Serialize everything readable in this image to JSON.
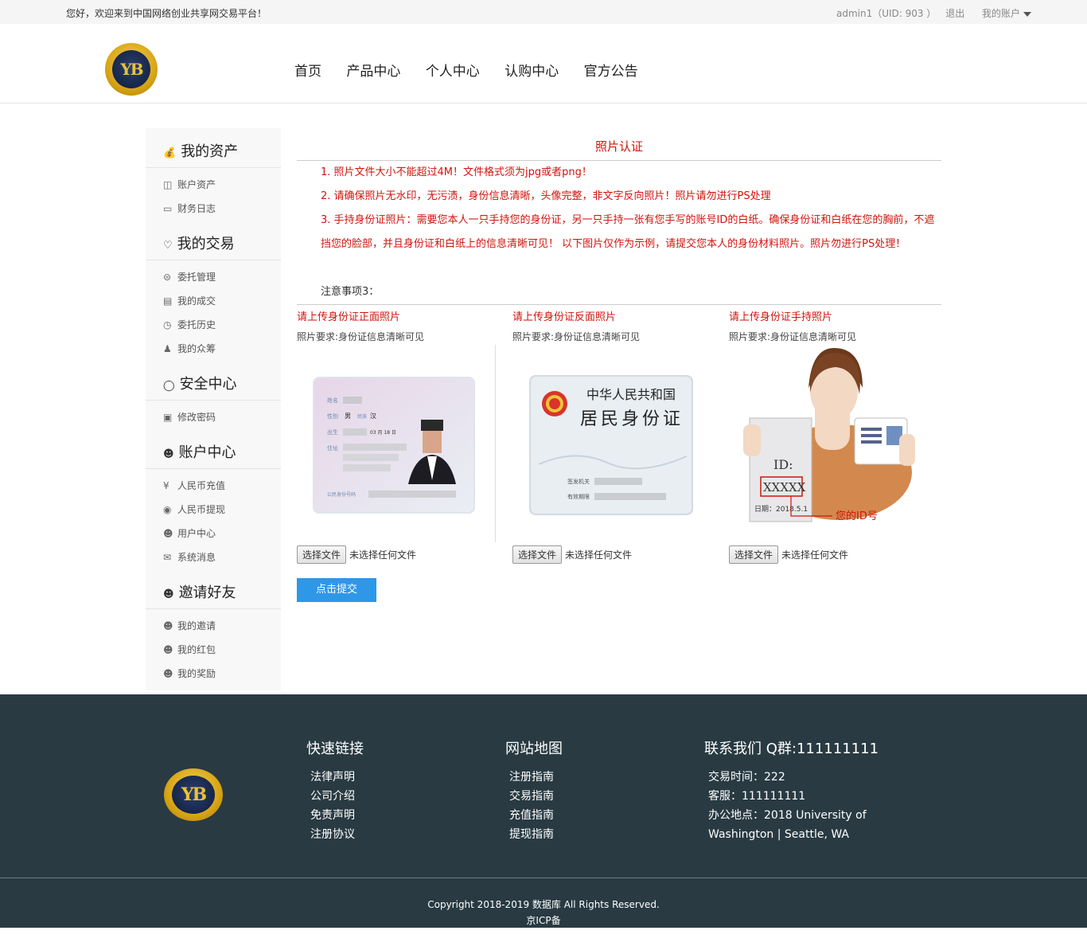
{
  "topbar": {
    "welcome": "您好，欢迎来到中国网络创业共享网交易平台！",
    "user": "admin1（UID: 903 ）",
    "logout": "退出",
    "account": "我的账户"
  },
  "brand": {
    "logo_text": "YB"
  },
  "nav": [
    "首页",
    "产品中心",
    "个人中心",
    "认购中心",
    "官方公告"
  ],
  "sidebar": [
    {
      "title": "我的资产",
      "icon": "money-bag-icon",
      "items": [
        {
          "label": "账户资产",
          "icon": "database-icon"
        },
        {
          "label": "财务日志",
          "icon": "folder-icon"
        }
      ]
    },
    {
      "title": "我的交易",
      "icon": "heart-hand-icon",
      "items": [
        {
          "label": "委托管理",
          "icon": "list-circle-icon"
        },
        {
          "label": "我的成交",
          "icon": "card-icon"
        },
        {
          "label": "委托历史",
          "icon": "history-icon"
        },
        {
          "label": "我的众筹",
          "icon": "group-icon"
        }
      ]
    },
    {
      "title": "安全中心",
      "icon": "shield-icon",
      "items": [
        {
          "label": "修改密码",
          "icon": "lock-icon"
        }
      ]
    },
    {
      "title": "账户中心",
      "icon": "user-icon",
      "items": [
        {
          "label": "人民币充值",
          "icon": "yen-icon"
        },
        {
          "label": "人民币提现",
          "icon": "coins-icon"
        },
        {
          "label": "用户中心",
          "icon": "user-icon"
        },
        {
          "label": "系统消息",
          "icon": "mail-icon"
        }
      ]
    },
    {
      "title": "邀请好友",
      "icon": "user-icon",
      "items": [
        {
          "label": "我的邀请",
          "icon": "user-add-icon"
        },
        {
          "label": "我的红包",
          "icon": "user-add-icon"
        },
        {
          "label": "我的奖励",
          "icon": "user-add-icon"
        }
      ]
    }
  ],
  "main": {
    "title": "照片认证",
    "notes": [
      "1. 照片文件大小不能超过4M！文件格式须为jpg或者png！",
      "2. 请确保照片无水印，无污渍，身份信息清晰，头像完整，非文字反向照片！照片请勿进行PS处理",
      "3. 手持身份证照片：需要您本人一只手持您的身份证，另一只手持一张有您手写的账号ID的白纸。确保身份证和白纸在您的胸前，不遮挡您的脸部，并且身份证和白纸上的信息清晰可见！ 以下图片仅作为示例，请提交您本人的身份材料照片。照片勿进行PS处理！"
    ],
    "note_extra": "注意事项3：",
    "uploads": [
      {
        "label": "请上传身份证正面照片",
        "req": "照片要求:身份证信息清晰可见"
      },
      {
        "label": "请上传身份证反面照片",
        "req": "照片要求:身份证信息清晰可见"
      },
      {
        "label": "请上传身份证手持照片",
        "req": "照片要求:身份证信息清晰可见"
      }
    ],
    "file_button": "选择文件",
    "file_status": "未选择任何文件",
    "submit": "点击提交",
    "front_card": {
      "f1": "姓名",
      "f2": "性别",
      "gender": "男",
      "nation_label": "民族",
      "nation": "汉",
      "f3": "出生",
      "birth": "03 月 18 日",
      "f4": "住址",
      "f5": "公民身份号码"
    },
    "back_card": {
      "line1": "中华人民共和国",
      "line2": "居民身份证",
      "f1": "签发机关",
      "f2": "有效期限"
    },
    "hand_card": {
      "id": "ID:",
      "xxxxx": "XXXXX",
      "date": "日期：2018.5.1",
      "arrow": "您的ID号"
    }
  },
  "footer": {
    "col1": {
      "title": "快速链接",
      "items": [
        "法律声明",
        "公司介绍",
        "免责声明",
        "注册协议"
      ]
    },
    "col2": {
      "title": "网站地图",
      "items": [
        "注册指南",
        "交易指南",
        "充值指南",
        "提现指南"
      ]
    },
    "col3": {
      "title": "联系我们 Q群:111111111",
      "items": [
        "交易时间：222",
        "客服：111111111",
        "办公地点：2018 University of",
        "Washington | Seattle, WA"
      ]
    },
    "copyright": "Copyright 2018-2019 数据库 All Rights Reserved.",
    "icp": "京ICP备"
  }
}
